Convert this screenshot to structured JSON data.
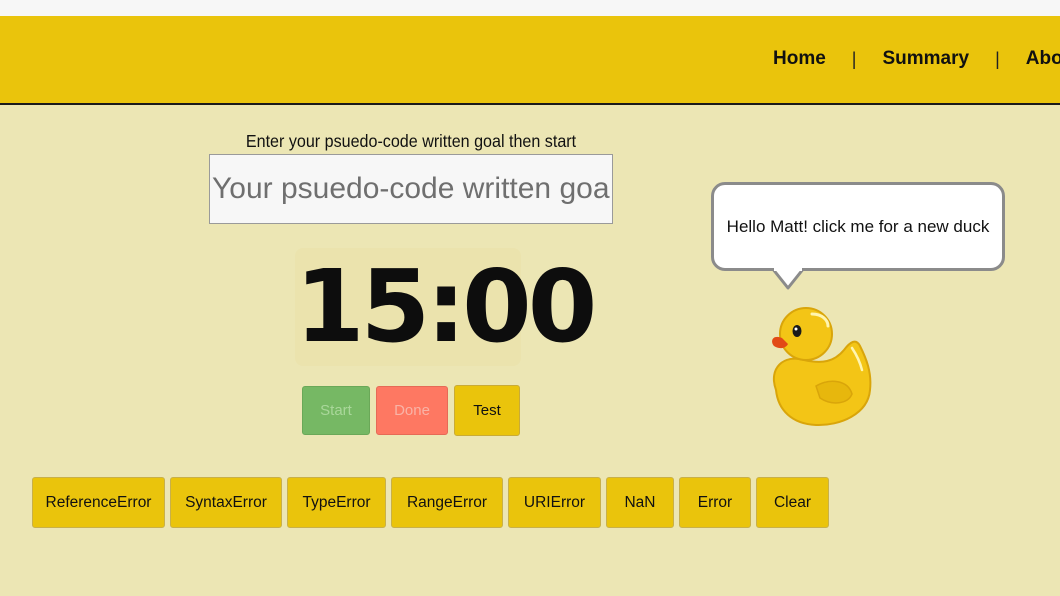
{
  "nav": {
    "home": "Home",
    "separator": "|",
    "summary": "Summary",
    "about": "About Us"
  },
  "goal": {
    "label": "Enter your psuedo-code written goal then start timer:",
    "placeholder": "Your psuedo-code written goal:",
    "value": ""
  },
  "timer": {
    "display": "15:00"
  },
  "controls": {
    "start": "Start",
    "done": "Done",
    "test": "Test"
  },
  "errors": [
    "ReferenceError",
    "SyntaxError",
    "TypeError",
    "RangeError",
    "URIError",
    "NaN",
    "Error",
    "Clear"
  ],
  "duck": {
    "message": "Hello Matt! click me for a new duck"
  },
  "colors": {
    "background": "#ece6b4",
    "header": "#eac40c",
    "start_button": "#76b864",
    "done_button": "#fe7862",
    "duck_body": "#f3c516"
  }
}
